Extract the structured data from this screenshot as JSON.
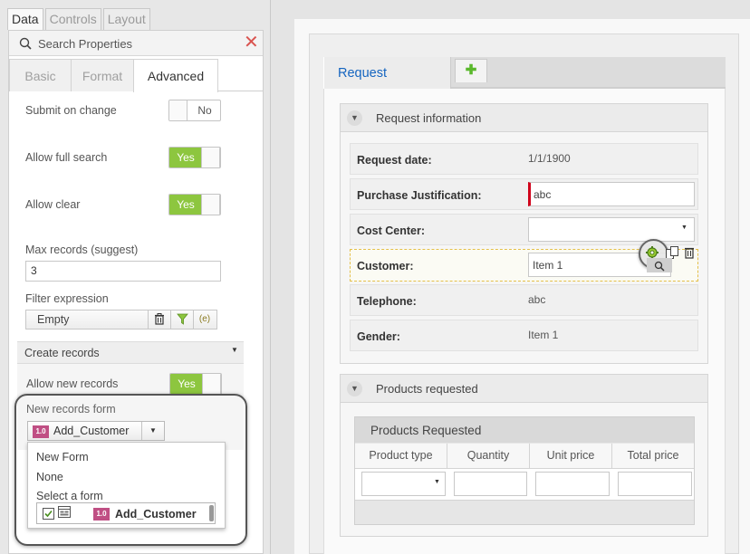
{
  "left_panel": {
    "top_tabs": [
      "Data",
      "Controls",
      "Layout"
    ],
    "search": {
      "placeholder": "Search Properties"
    },
    "sub_tabs": [
      "Basic",
      "Format",
      "Advanced"
    ],
    "props": {
      "submit_on_change": {
        "label": "Submit on change",
        "value": "No"
      },
      "allow_full_search": {
        "label": "Allow full search",
        "value": "Yes"
      },
      "allow_clear": {
        "label": "Allow clear",
        "value": "Yes"
      },
      "max_records": {
        "label": "Max records (suggest)",
        "value": "3"
      },
      "filter_expression": {
        "label": "Filter expression",
        "value": "Empty"
      },
      "create_records": {
        "label": "Create records"
      },
      "allow_new_records": {
        "label": "Allow new records",
        "value": "Yes"
      },
      "new_records_form": {
        "label": "New records form",
        "badge": "1.0",
        "selected": "Add_Customer",
        "options": [
          "New Form",
          "None",
          "Select a form"
        ],
        "list_item": {
          "badge": "1.0",
          "name": "Add_Customer"
        }
      }
    }
  },
  "form": {
    "tabs": [
      {
        "label": "Request"
      }
    ],
    "add_tab_icon": "plus-icon",
    "groups": [
      {
        "title": "Request information",
        "fields": [
          {
            "label": "Request date:",
            "value": "1/1/1900"
          },
          {
            "label": "Purchase Justification:",
            "value": "abc"
          },
          {
            "label": "Cost Center:",
            "value": ""
          },
          {
            "label": "Customer:",
            "value": "Item 1"
          },
          {
            "label": "Telephone:",
            "value": "abc"
          },
          {
            "label": "Gender:",
            "value": "Item 1"
          }
        ]
      },
      {
        "title": "Products requested",
        "grid": {
          "title": "Products Requested",
          "columns": [
            "Product type",
            "Quantity",
            "Unit price",
            "Total price"
          ]
        }
      }
    ]
  },
  "colors": {
    "toggle_on": "#8dc63f",
    "link_blue": "#1565c0",
    "required_red": "#d0021b",
    "badge_pink": "#c04f84"
  }
}
